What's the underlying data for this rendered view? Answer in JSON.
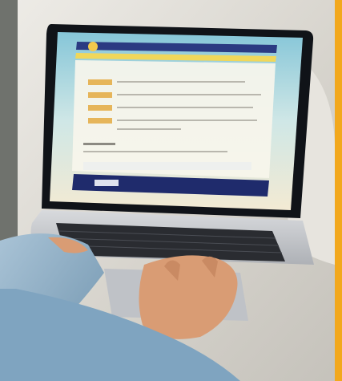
{
  "photo": {
    "accent_bar_color": "#f2a81d",
    "laptop_body_color": "#c9cbcf",
    "screen_bezel_color": "#101318",
    "sleeve_color": "#8fb0c9",
    "skin_color": "#d99c74"
  },
  "screen": {
    "header_color": "#2b3a82",
    "nav_color": "#f0d75a",
    "body_color": "#f7f5ec",
    "button_color": "#e6b55a",
    "footer_color": "#1f2b6c"
  }
}
